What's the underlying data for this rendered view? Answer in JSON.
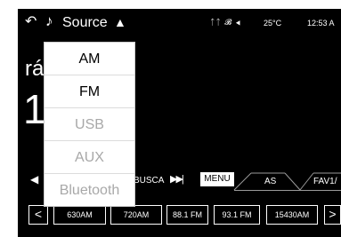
{
  "topbar": {
    "back_icon": "↶",
    "music_icon": "♪",
    "source_label": "Source",
    "caret_icon": "▲",
    "status_icons": "ᛏᛏ 𝓑 ◀",
    "temperature": "25°C",
    "clock": "12:53 A"
  },
  "main": {
    "station_name": "rá",
    "frequency": "1      Z"
  },
  "source_menu": {
    "items": [
      {
        "label": "AM",
        "enabled": true
      },
      {
        "label": "FM",
        "enabled": true
      },
      {
        "label": "USB",
        "enabled": false
      },
      {
        "label": "AUX",
        "enabled": false
      },
      {
        "label": "Bluetooth",
        "enabled": false
      }
    ]
  },
  "controls": {
    "prev_icon": "◀",
    "busca_label": "BUSCA",
    "next_icon": "▶▶|",
    "menu_label": "MENU",
    "tab_as": "AS",
    "tab_fav": "FAV1/"
  },
  "presets": {
    "prev_icon": "<",
    "items": [
      "630AM",
      "720AM",
      "88.1 FM",
      "93.1 FM",
      "15430AM"
    ],
    "next_icon": ">"
  }
}
